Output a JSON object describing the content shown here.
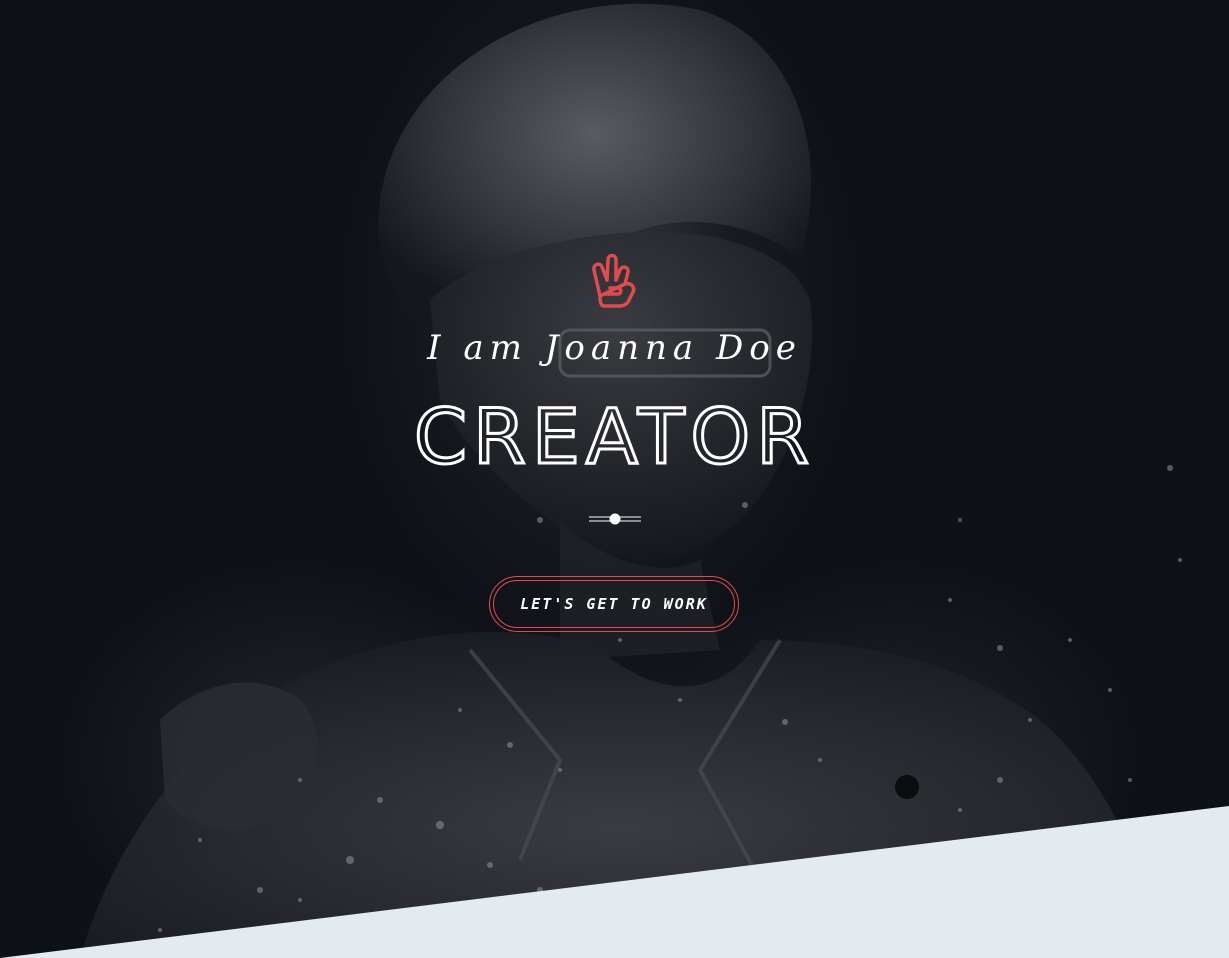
{
  "hero": {
    "intro": "I am Joanna Doe",
    "role": "CREATOR",
    "cta_label": "LET'S GET TO WORK",
    "icon": "peace-hand-icon"
  },
  "colors": {
    "background": "#0e1117",
    "accent": "#e24b4b",
    "text": "#ffffff",
    "section_below": "#e3ebee"
  }
}
